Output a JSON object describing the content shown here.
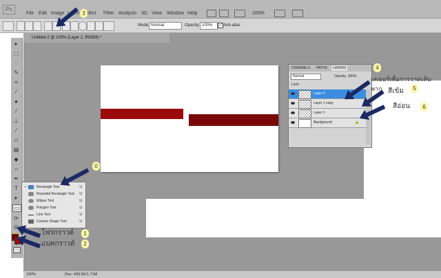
{
  "menu": [
    "File",
    "Edit",
    "Image",
    "Layer",
    "Select",
    "Filter",
    "Analysis",
    "3D",
    "View",
    "Window",
    "Help"
  ],
  "zoom_menu": "100%",
  "options": {
    "mode_label": "Mode:",
    "mode_value": "Normal",
    "opacity_label": "Opacity:",
    "opacity_value": "100%",
    "antialias_label": "Anti-alias"
  },
  "document": {
    "tab_title": "Untitled-2 @ 100% (Layer 2, RGB/8) *",
    "status_zoom": "100%",
    "status_doc": "Doc: 439.5K/1.71M",
    "colors": {
      "bar1": "#9b0a0a",
      "bar2": "#7a0808"
    }
  },
  "layers": {
    "tabs": [
      "CHANNELS",
      "PATHS",
      "LAYERS"
    ],
    "blend": "Normal",
    "opacity": "Opacity: 100%",
    "lock": "Lock:",
    "items": [
      "Layer 2",
      "Layer 1 copy",
      "Layer 1",
      "Background"
    ]
  },
  "flyout": {
    "items": [
      {
        "label": "Rectangle Tool",
        "key": "U"
      },
      {
        "label": "Rounded Rectangle Tool",
        "key": "U"
      },
      {
        "label": "Ellipse Tool",
        "key": "U"
      },
      {
        "label": "Polygon Tool",
        "key": "U"
      },
      {
        "label": "Line Tool",
        "key": "U"
      },
      {
        "label": "Custom Shape Tool",
        "key": "U"
      }
    ]
  },
  "annotations": {
    "n0": "0",
    "n1": "1",
    "n2": "2",
    "n3": "3",
    "n4": "4",
    "n5": "5",
    "n6": "6",
    "foreground": "โฟรกราวด์",
    "background": "แบคกราวด์",
    "layer_for_line": "เลเยอร์เพื่อการวาดเส้นพาก",
    "dark": "สีเข้ม",
    "light": "สีอ่อน"
  }
}
